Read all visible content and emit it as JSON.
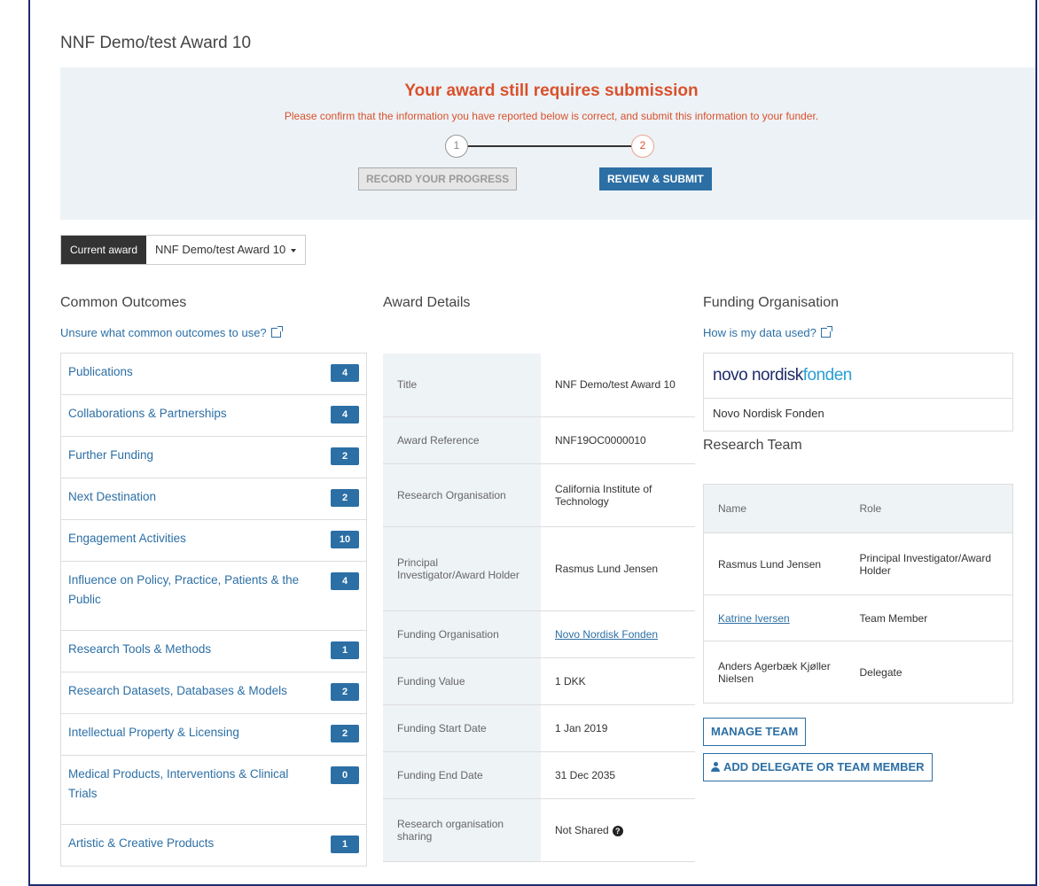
{
  "award_title": "NNF Demo/test Award 10",
  "banner": {
    "heading": "Your award still requires submission",
    "subtext": "Please confirm that the information you have reported below is correct, and submit this information to your funder.",
    "step1_number": "1",
    "step2_number": "2",
    "step1_label": "RECORD YOUR PROGRESS",
    "step2_label": "REVIEW & SUBMIT"
  },
  "award_selector": {
    "label": "Current award",
    "value": "NNF Demo/test Award 10"
  },
  "common_outcomes": {
    "heading": "Common Outcomes",
    "help_link": "Unsure what common outcomes to use?",
    "items": [
      {
        "label": "Publications",
        "count": "4"
      },
      {
        "label": "Collaborations & Partnerships",
        "count": "4"
      },
      {
        "label": "Further Funding",
        "count": "2"
      },
      {
        "label": "Next Destination",
        "count": "2"
      },
      {
        "label": "Engagement Activities",
        "count": "10"
      },
      {
        "label": "Influence on Policy, Practice, Patients & the Public",
        "count": "4"
      },
      {
        "label": "Research Tools & Methods",
        "count": "1"
      },
      {
        "label": "Research Datasets, Databases & Models",
        "count": "2"
      },
      {
        "label": "Intellectual Property & Licensing",
        "count": "2"
      },
      {
        "label": "Medical Products, Interventions & Clinical Trials",
        "count": "0"
      },
      {
        "label": "Artistic & Creative Products",
        "count": "1"
      }
    ]
  },
  "award_details": {
    "heading": "Award Details",
    "rows": [
      {
        "key": "Title",
        "value": "NNF Demo/test Award 10"
      },
      {
        "key": "Award Reference",
        "value": "NNF19OC0000010"
      },
      {
        "key": "Research Organisation",
        "value": "California Institute of Technology"
      },
      {
        "key": "Principal Investigator/Award Holder",
        "value": "Rasmus Lund Jensen"
      },
      {
        "key": "Funding Organisation",
        "value": "Novo Nordisk Fonden"
      },
      {
        "key": "Funding Value",
        "value": "1 DKK"
      },
      {
        "key": "Funding Start Date",
        "value": "1 Jan 2019"
      },
      {
        "key": "Funding End Date",
        "value": "31 Dec 2035"
      },
      {
        "key": "Research organisation sharing",
        "value": "Not Shared"
      }
    ]
  },
  "funding_org": {
    "heading": "Funding Organisation",
    "help_link": "How is my data used?",
    "logo_part1": "novo nordisk",
    "logo_part2": "fonden",
    "name": "Novo Nordisk Fonden"
  },
  "research_team": {
    "heading": "Research Team",
    "col_name": "Name",
    "col_role": "Role",
    "members": [
      {
        "name": "Rasmus Lund Jensen",
        "role": "Principal Investigator/Award Holder"
      },
      {
        "name": "Katrine Iversen",
        "role": "Team Member"
      },
      {
        "name": "Anders Agerbæk Kjøller Nielsen",
        "role": "Delegate"
      }
    ],
    "manage_label": "MANAGE TEAM",
    "add_label": "ADD DELEGATE OR TEAM MEMBER"
  },
  "colors": {
    "accent": "#2c6fa5",
    "warning": "#d9512c",
    "frame": "#1f2c6b"
  }
}
